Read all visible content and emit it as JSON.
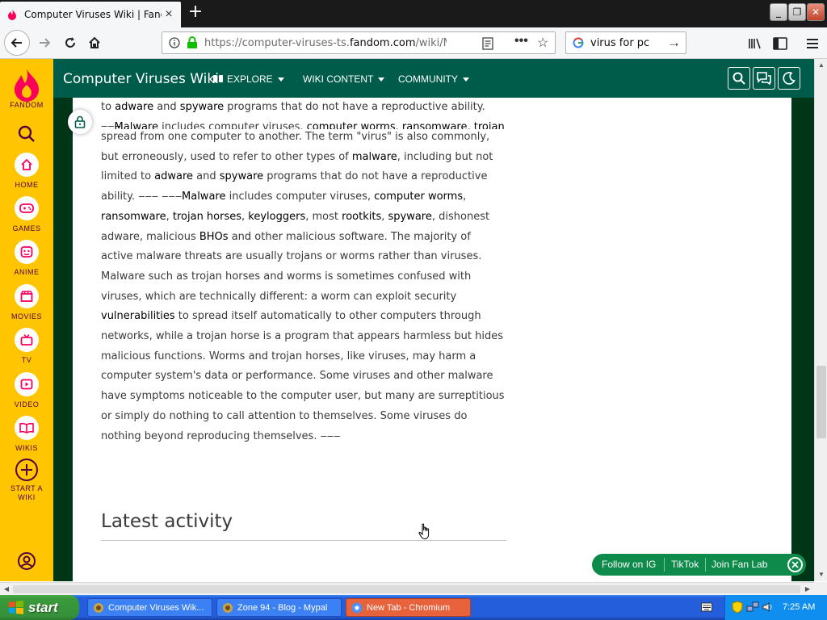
{
  "browser": {
    "tab_title": "Computer Viruses Wiki | Fandom",
    "tab_close": "×",
    "new_tab": "+",
    "url_prefix": "https://computer-viruses-ts.",
    "url_domain": "fandom.com",
    "url_path": "/wiki/Main_P",
    "search_text": "virus for pc"
  },
  "rail": {
    "logo_label": "FANDOM",
    "items": [
      {
        "label": "HOME",
        "icon": "home-icon"
      },
      {
        "label": "GAMES",
        "icon": "gamepad-icon"
      },
      {
        "label": "ANIME",
        "icon": "anime-icon"
      },
      {
        "label": "MOVIES",
        "icon": "clapper-icon"
      },
      {
        "label": "TV",
        "icon": "tv-icon"
      },
      {
        "label": "VIDEO",
        "icon": "play-icon"
      },
      {
        "label": "WIKIS",
        "icon": "book-icon"
      }
    ],
    "start_wiki_line1": "START A",
    "start_wiki_line2": "WIKI"
  },
  "header": {
    "wiki_title": "Computer Viruses Wiki",
    "nav": [
      "EXPLORE",
      "WIKI CONTENT",
      "COMMUNITY"
    ]
  },
  "article": {
    "fragment": {
      "t1": "to ",
      "l1": "adware",
      "t2": " and ",
      "l2": "spyware",
      "t3": " programs that do not have a reproductive ability. ‒‒‒"
    },
    "overlap": {
      "l1": "Malware",
      "t1": " includes computer viruses, ",
      "l2": "computer worms",
      "t2": ", ",
      "l3": "ransomware",
      "t3": ", ",
      "l4": "trojan"
    },
    "main": {
      "p1": "spread from one computer to another. The term \"virus\" is also commonly, but erroneously, used to refer to other types of ",
      "l_malware": "malware",
      "p2": ", including but not limited to ",
      "l_adware": "adware",
      "p3": " and ",
      "l_spyware": "spyware",
      "p4": " programs that do not have a reproductive ability. ‒‒‒ ‒‒‒",
      "l_malware2": "Malware",
      "p5": " includes computer viruses, ",
      "l_worms": "computer worms",
      "p6": ", ",
      "l_ransomware": "ransomware",
      "p7": ", ",
      "l_trojans": "trojan horses",
      "p8": ", ",
      "l_keyloggers": "keyloggers",
      "p9": ", most ",
      "l_rootkits": "rootkits",
      "p10": ", ",
      "l_spyware2": "spyware",
      "p11": ", dishonest adware, malicious ",
      "l_bhos": "BHOs",
      "p12": " and other malicious software. The majority of active malware threats are usually trojans or worms rather than viruses. Malware such as trojan horses and worms is sometimes confused with viruses, which are technically different: a worm can exploit security ",
      "l_vuln": "vulnerabilities",
      "p13": " to spread itself automatically to other computers through networks, while a trojan horse is a program that appears harmless but hides malicious functions. Worms and trojan horses, like viruses, may harm a computer system's data or performance. Some viruses and other malware have symptoms noticeable to the computer user, but many are surreptitious or simply do nothing to call attention to themselves. Some viruses do nothing beyond reproducing themselves. ‒‒‒"
    },
    "latest_activity": "Latest activity"
  },
  "social": {
    "follow_ig": "Follow on IG",
    "tiktok": "TikTok",
    "join_lab": "Join Fan Lab"
  },
  "taskbar": {
    "start": "start",
    "tasks": [
      "Computer Viruses Wik...",
      "Zone 94 - Blog - Mypal",
      "New Tab - Chromium"
    ],
    "clock": "7:25 AM"
  },
  "colors": {
    "fandom_rail": "#ffc500",
    "wiki_header": "#005c4a",
    "page_background": "#003618",
    "social_bar": "#0e8b4a",
    "fandom_pink": "#fa005a",
    "xp_taskbar": "#245edb",
    "xp_start": "#3a9a3a"
  }
}
